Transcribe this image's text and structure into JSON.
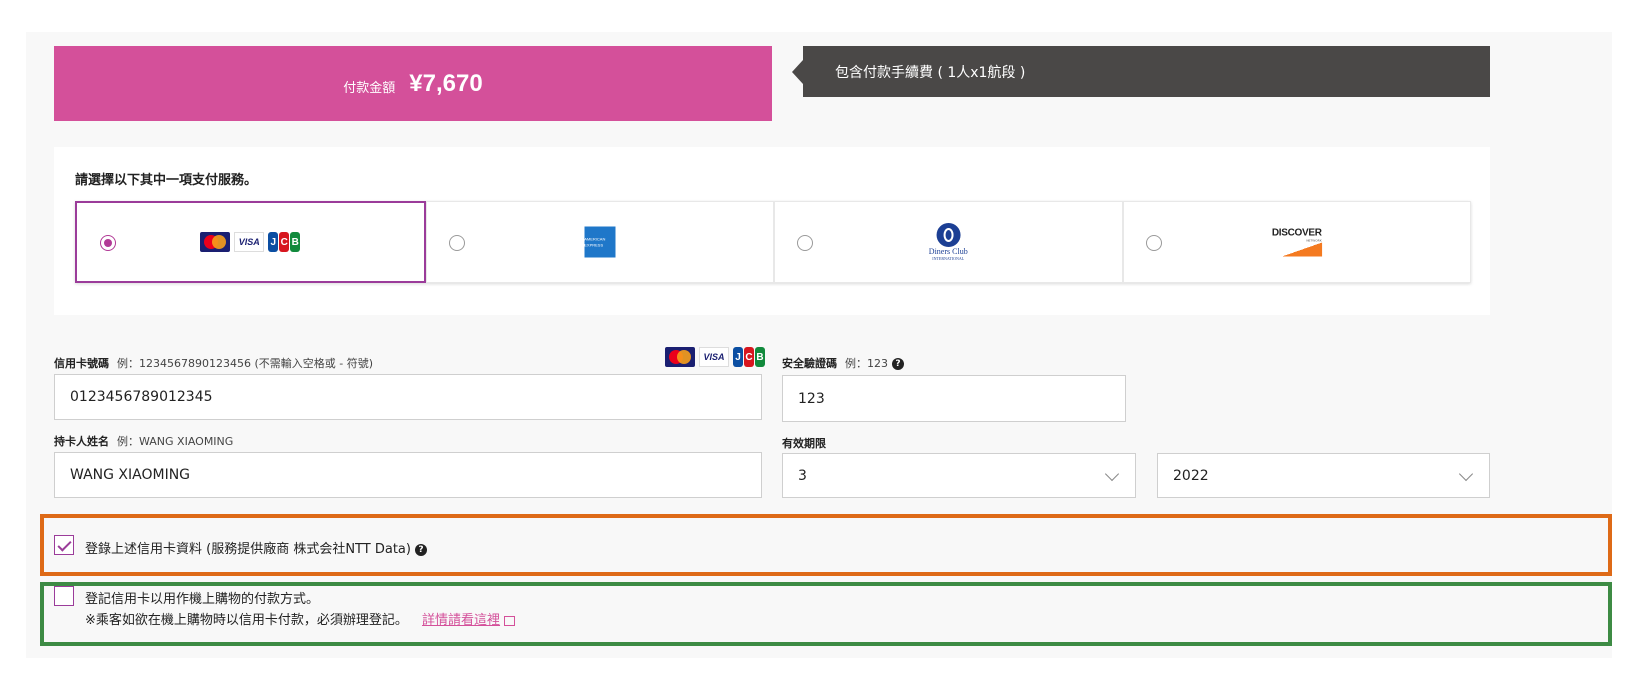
{
  "amount": {
    "label": "付款金額",
    "value": "¥7,670"
  },
  "fee_note": "包含付款手續費 ( 1人x1航段 )",
  "payment": {
    "title": "請選擇以下其中一項支付服務。",
    "options": [
      {
        "name": "mastercard-visa-jcb",
        "selected": true
      },
      {
        "name": "amex",
        "selected": false,
        "logo_text": "AMERICAN EXPRESS"
      },
      {
        "name": "diners",
        "selected": false,
        "logo_text": "Diners Club",
        "logo_sub": "INTERNATIONAL"
      },
      {
        "name": "discover",
        "selected": false,
        "logo_text": "DISCOVER",
        "logo_sub": "NETWORK"
      }
    ]
  },
  "card_number": {
    "label": "信用卡號碼",
    "example": "例：1234567890123456 (不需輸入空格或 - 符號)",
    "value": "0123456789012345"
  },
  "cvv": {
    "label": "安全驗證碼",
    "example": "例：123",
    "value": "123"
  },
  "holder": {
    "label": "持卡人姓名",
    "example": "例：WANG XIAOMING",
    "value": "WANG XIAOMING"
  },
  "expiry": {
    "label": "有效期限",
    "month": "3",
    "year": "2022"
  },
  "register_card": {
    "text": "登錄上述信用卡資料 (服務提供廠商 株式会社NTT Data)",
    "checked": true
  },
  "inflight": {
    "line1": "登記信用卡以用作機上購物的付款方式。",
    "line2": "※乘客如欲在機上購物時以信用卡付款，必須辦理登記。",
    "link": "詳情請看這裡",
    "checked": false
  },
  "logo_text": {
    "visa": "VISA",
    "jcb": [
      "J",
      "C",
      "B"
    ]
  },
  "colors": {
    "brand_pink": "#d4509a",
    "dark_note": "#4a4847",
    "accent_purple": "#9b3c9a",
    "highlight_orange": "#de6a17",
    "highlight_green": "#3d8b44"
  }
}
